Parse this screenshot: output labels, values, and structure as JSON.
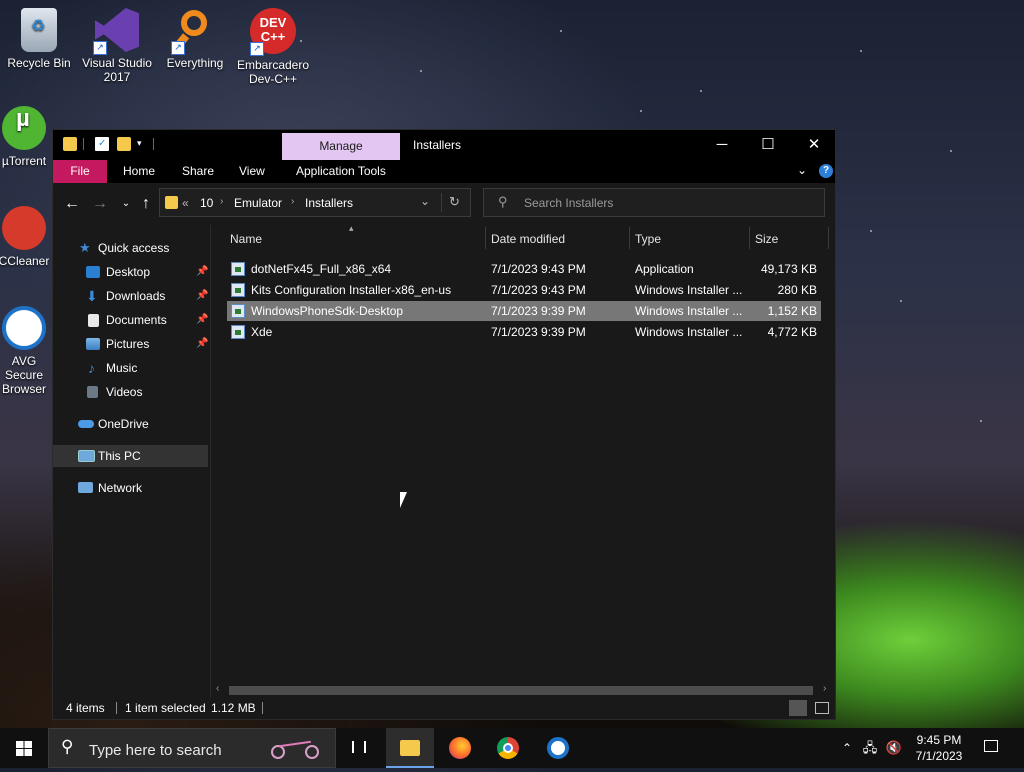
{
  "desktop": {
    "icons": [
      {
        "label": "Recycle Bin"
      },
      {
        "label": "Visual Studio 2017"
      },
      {
        "label": "Everything"
      },
      {
        "label": "Embarcadero Dev-C++",
        "glyph": "DEV C++"
      },
      {
        "label": "µTorrent"
      },
      {
        "label": "CCleaner"
      },
      {
        "label": "AVG Secure Browser"
      }
    ]
  },
  "window": {
    "title": "Installers",
    "context_tab": "Manage",
    "ribbon": {
      "file": "File",
      "tabs": [
        "Home",
        "Share",
        "View",
        "Application Tools"
      ]
    },
    "address": {
      "overflow": "«",
      "crumbs": [
        "10",
        "Emulator",
        "Installers"
      ]
    },
    "search": {
      "placeholder": "Search Installers"
    },
    "nav": {
      "quick_access": "Quick access",
      "items": [
        {
          "label": "Desktop",
          "pinned": true
        },
        {
          "label": "Downloads",
          "pinned": true
        },
        {
          "label": "Documents",
          "pinned": true
        },
        {
          "label": "Pictures",
          "pinned": true
        },
        {
          "label": "Music",
          "pinned": false
        },
        {
          "label": "Videos",
          "pinned": false
        }
      ],
      "onedrive": "OneDrive",
      "this_pc": "This PC",
      "network": "Network"
    },
    "columns": [
      "Name",
      "Date modified",
      "Type",
      "Size"
    ],
    "files": [
      {
        "name": "dotNetFx45_Full_x86_x64",
        "date": "7/1/2023 9:43 PM",
        "type": "Application",
        "size": "49,173 KB",
        "selected": false
      },
      {
        "name": "Kits Configuration Installer-x86_en-us",
        "date": "7/1/2023 9:43 PM",
        "type": "Windows Installer ...",
        "size": "280 KB",
        "selected": false
      },
      {
        "name": "WindowsPhoneSdk-Desktop",
        "date": "7/1/2023 9:39 PM",
        "type": "Windows Installer ...",
        "size": "1,152 KB",
        "selected": true
      },
      {
        "name": "Xde",
        "date": "7/1/2023 9:39 PM",
        "type": "Windows Installer ...",
        "size": "4,772 KB",
        "selected": false
      }
    ],
    "status": {
      "count": "4 items",
      "selection": "1 item selected",
      "size": "1.12 MB"
    }
  },
  "taskbar": {
    "search_placeholder": "Type here to search",
    "time": "9:45 PM",
    "date": "7/1/2023"
  },
  "colors": {
    "file_tab": "#c4195f",
    "manage_tab": "#e3c6f1",
    "selection": "#777777",
    "window_bg": "#191919"
  }
}
